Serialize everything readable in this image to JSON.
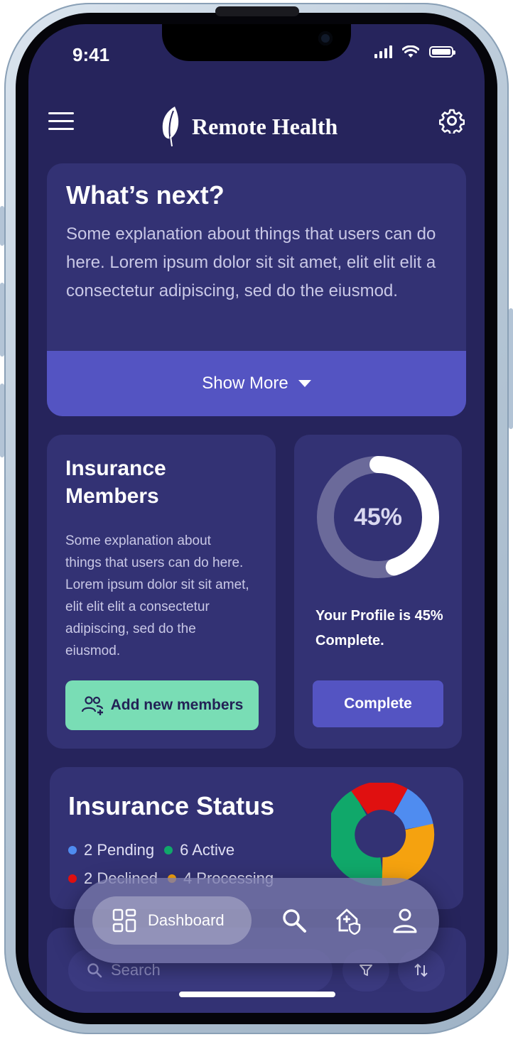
{
  "status_bar": {
    "time": "9:41"
  },
  "header": {
    "title": "Remote Health",
    "logo_icon": "feather-icon",
    "menu_icon": "hamburger-icon",
    "settings_icon": "gear-icon"
  },
  "whats_next": {
    "title": "What’s next?",
    "body": "Some explanation about things that users can do here. Lorem ipsum dolor sit sit amet, elit elit elit a consectetur adipiscing, sed do the eiusmod.",
    "show_more_label": "Show More"
  },
  "insurance_members": {
    "title": "Insurance Members",
    "body": "Some explanation about things that users can do here. Lorem ipsum dolor sit sit amet, elit elit elit a consectetur adipiscing, sed do the eiusmod.",
    "button_label": "Add new members"
  },
  "profile": {
    "progress_label": "45%",
    "progress_value": 0.45,
    "text": "Your Profile is 45% Complete.",
    "button_label": "Complete"
  },
  "insurance_status": {
    "title": "Insurance Status",
    "legend": [
      {
        "label": "2 Pending",
        "color": "#4f8cf0"
      },
      {
        "label": "6 Active",
        "color": "#10a86a"
      },
      {
        "label": "2 Declined",
        "color": "#e01010"
      },
      {
        "label": "4 Processing",
        "color": "#f5a20f"
      }
    ]
  },
  "search": {
    "placeholder": "Search"
  },
  "bottom_nav": {
    "active_label": "Dashboard",
    "items": [
      "dashboard-icon",
      "search-icon",
      "home-shield-icon",
      "profile-icon"
    ]
  },
  "colors": {
    "background": "#26245c",
    "card": "#333274",
    "accent": "#5454c2",
    "green_button": "#79ddb5"
  }
}
